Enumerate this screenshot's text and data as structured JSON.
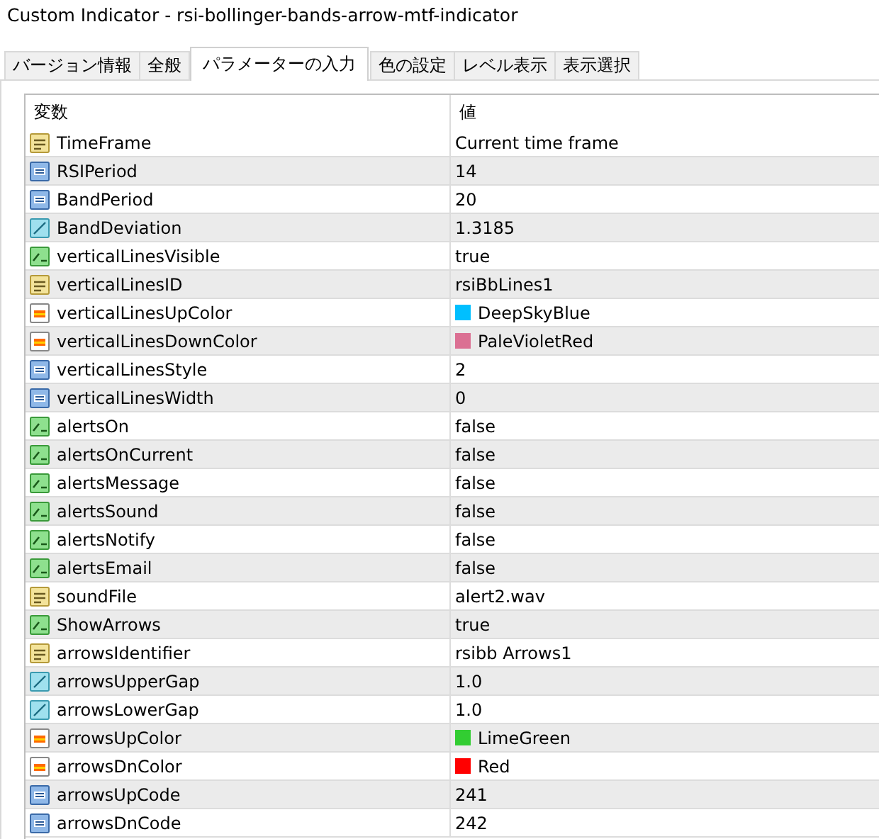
{
  "window": {
    "title": "Custom Indicator - rsi-bollinger-bands-arrow-mtf-indicator"
  },
  "tabs": [
    {
      "label": "バージョン情報",
      "selected": false
    },
    {
      "label": "全般",
      "selected": false
    },
    {
      "label": "パラメーターの入力",
      "selected": true
    },
    {
      "label": "色の設定",
      "selected": false
    },
    {
      "label": "レベル表示",
      "selected": false
    },
    {
      "label": "表示選択",
      "selected": false
    }
  ],
  "table": {
    "columns": [
      "変数",
      "値"
    ],
    "rows": [
      {
        "kind": "string",
        "name": "TimeFrame",
        "value": "Current time frame"
      },
      {
        "kind": "int",
        "name": "RSIPeriod",
        "value": "14"
      },
      {
        "kind": "int",
        "name": "BandPeriod",
        "value": "20"
      },
      {
        "kind": "double",
        "name": "BandDeviation",
        "value": "1.3185"
      },
      {
        "kind": "bool",
        "name": "verticalLinesVisible",
        "value": "true"
      },
      {
        "kind": "string",
        "name": "verticalLinesID",
        "value": "rsiBbLines1"
      },
      {
        "kind": "color",
        "name": "verticalLinesUpColor",
        "value": "DeepSkyBlue",
        "color": "#00bfff"
      },
      {
        "kind": "color",
        "name": "verticalLinesDownColor",
        "value": "PaleVioletRed",
        "color": "#db7093"
      },
      {
        "kind": "int",
        "name": "verticalLinesStyle",
        "value": "2"
      },
      {
        "kind": "int",
        "name": "verticalLinesWidth",
        "value": "0"
      },
      {
        "kind": "bool",
        "name": "alertsOn",
        "value": "false"
      },
      {
        "kind": "bool",
        "name": "alertsOnCurrent",
        "value": "false"
      },
      {
        "kind": "bool",
        "name": "alertsMessage",
        "value": "false"
      },
      {
        "kind": "bool",
        "name": "alertsSound",
        "value": "false"
      },
      {
        "kind": "bool",
        "name": "alertsNotify",
        "value": "false"
      },
      {
        "kind": "bool",
        "name": "alertsEmail",
        "value": "false"
      },
      {
        "kind": "string",
        "name": "soundFile",
        "value": "alert2.wav"
      },
      {
        "kind": "bool",
        "name": "ShowArrows",
        "value": "true"
      },
      {
        "kind": "string",
        "name": "arrowsIdentifier",
        "value": "rsibb Arrows1"
      },
      {
        "kind": "double",
        "name": "arrowsUpperGap",
        "value": "1.0"
      },
      {
        "kind": "double",
        "name": "arrowsLowerGap",
        "value": "1.0"
      },
      {
        "kind": "color",
        "name": "arrowsUpColor",
        "value": "LimeGreen",
        "color": "#32cd32"
      },
      {
        "kind": "color",
        "name": "arrowsDnColor",
        "value": "Red",
        "color": "#ff0000"
      },
      {
        "kind": "int",
        "name": "arrowsUpCode",
        "value": "241"
      },
      {
        "kind": "int",
        "name": "arrowsDnCode",
        "value": "242"
      }
    ]
  }
}
